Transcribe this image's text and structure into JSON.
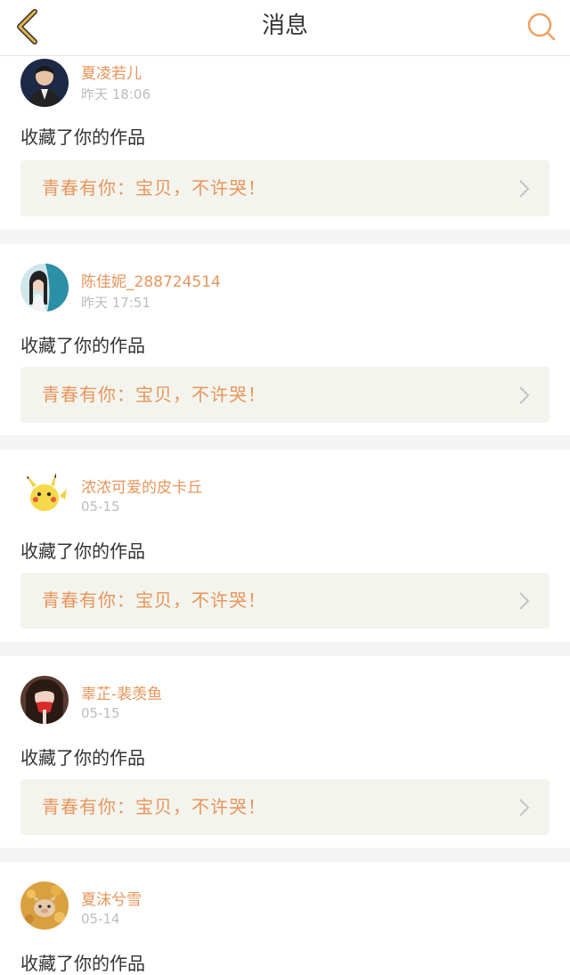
{
  "header": {
    "title": "消息",
    "back_icon": "back-chevron-icon",
    "search_icon": "search-icon",
    "accent_color": "#e8b44a"
  },
  "colors": {
    "name": "#e8955a",
    "time": "#bdbdbd",
    "text": "#333333",
    "box_bg": "#f4f4ee"
  },
  "messages": [
    {
      "username": "夏凌若儿",
      "time": "昨天 18:06",
      "action": "收藏了你的作品",
      "work_title": "青春有你：宝贝，不许哭！"
    },
    {
      "username": "陈佳妮_288724514",
      "time": "昨天 17:51",
      "action": "收藏了你的作品",
      "work_title": "青春有你：宝贝，不许哭！"
    },
    {
      "username": "浓浓可爱的皮卡丘",
      "time": "05-15",
      "action": "收藏了你的作品",
      "work_title": "青春有你：宝贝，不许哭！"
    },
    {
      "username": "辜芷-裴羡鱼",
      "time": "05-15",
      "action": "收藏了你的作品",
      "work_title": "青春有你：宝贝，不许哭！"
    },
    {
      "username": "夏沫兮雪",
      "time": "05-14",
      "action": "收藏了你的作品",
      "work_title": ""
    }
  ]
}
